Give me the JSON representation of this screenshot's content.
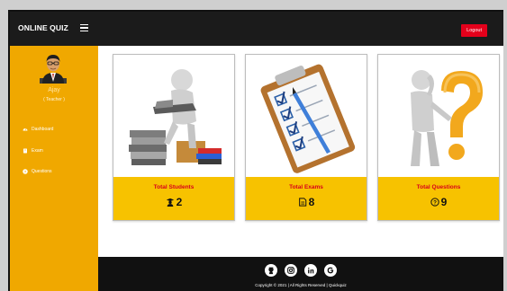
{
  "header": {
    "brand": "ONLINE QUIZ",
    "logout_label": "Logout"
  },
  "sidebar": {
    "user_name": "Ajay",
    "user_role": "( Teacher )",
    "items": [
      {
        "label": "Dashboard",
        "icon": "gauge-icon"
      },
      {
        "label": "Exam",
        "icon": "book-icon"
      },
      {
        "label": "Questions",
        "icon": "question-circle-icon"
      }
    ]
  },
  "cards": [
    {
      "title": "Total Students",
      "count": "2",
      "icon": "graduate-icon"
    },
    {
      "title": "Total Exams",
      "count": "8",
      "icon": "file-icon"
    },
    {
      "title": "Total Questions",
      "count": "9",
      "icon": "question-circle-icon"
    }
  ],
  "footer": {
    "social": [
      "github-icon",
      "instagram-icon",
      "linkedin-icon",
      "google-icon"
    ],
    "copyright": "Copyright © 2021 | All Rights Reserved | Quickquiz"
  },
  "colors": {
    "topbar": "#1b1b1b",
    "sidebar": "#f0a800",
    "card_footer": "#f7c200",
    "card_title": "#d8001a",
    "logout": "#e3001b"
  }
}
